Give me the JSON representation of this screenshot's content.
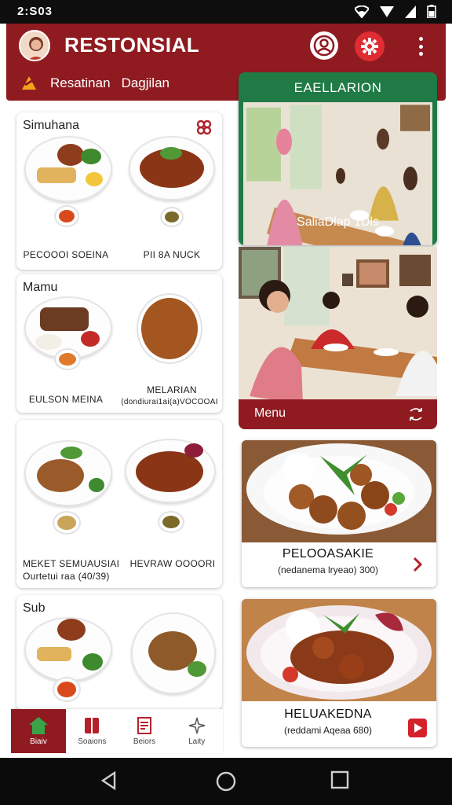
{
  "status_bar": {
    "time": "2:S03",
    "icons": [
      "wifi-icon",
      "signal-icon",
      "signal-icon",
      "battery-icon"
    ]
  },
  "app": {
    "title": "RESTONSIAL",
    "avatar": "avatar",
    "accent": "#8f1b21",
    "tab_icon": "restaurant-logo-icon"
  },
  "header_actions": [
    "account-icon",
    "gear-icon",
    "more-vertical-icon"
  ],
  "tabs": [
    {
      "label": "Resatinan"
    },
    {
      "label": "Dagjilan"
    }
  ],
  "sections": [
    {
      "title": "Simuhana",
      "corner_icon": "clover-icon",
      "dishes": [
        {
          "caption": "PECOOOI SOEINA"
        },
        {
          "caption": "PII 8A NUCK"
        }
      ]
    },
    {
      "title": "Mamu",
      "dishes": [
        {
          "caption": "EULSON MEINA"
        },
        {
          "caption": "MELARIAN",
          "sub": "(dondiurai1ai(a)VOCOOAI"
        }
      ]
    },
    {
      "title": "",
      "dishes": [
        {
          "caption": "MEKET SEMUAUSIAI",
          "sub": "Ourtetui raa (40/39)"
        },
        {
          "caption": "HEVRAW OOOORI"
        }
      ]
    },
    {
      "title": "Sub",
      "dishes": []
    }
  ],
  "bottom_nav": [
    {
      "label": "Biaiv",
      "icon": "home-icon",
      "active": true
    },
    {
      "label": "Soaions",
      "icon": "book-icon"
    },
    {
      "label": "Beiors",
      "icon": "receipt-icon"
    },
    {
      "label": "Laity",
      "icon": "sparkle-icon"
    }
  ],
  "featured": {
    "title": "EAELLARION",
    "caption": "SaliaDlap 1Dls",
    "color": "#1f7a45"
  },
  "menu_card": {
    "label": "Menu",
    "icon": "swap-icon"
  },
  "dish_cards": [
    {
      "name": "PELOOASAKIE",
      "sub": "(nedanema lryeao) 300)",
      "arrow_icon": "chevron-right-icon"
    },
    {
      "name": "HELUAKEDNA",
      "sub": "(reddami Aqeaa 680)",
      "arrow_icon": "play-arrow-icon"
    }
  ],
  "system_nav": [
    "back-icon",
    "home-circle-icon",
    "recents-icon"
  ]
}
